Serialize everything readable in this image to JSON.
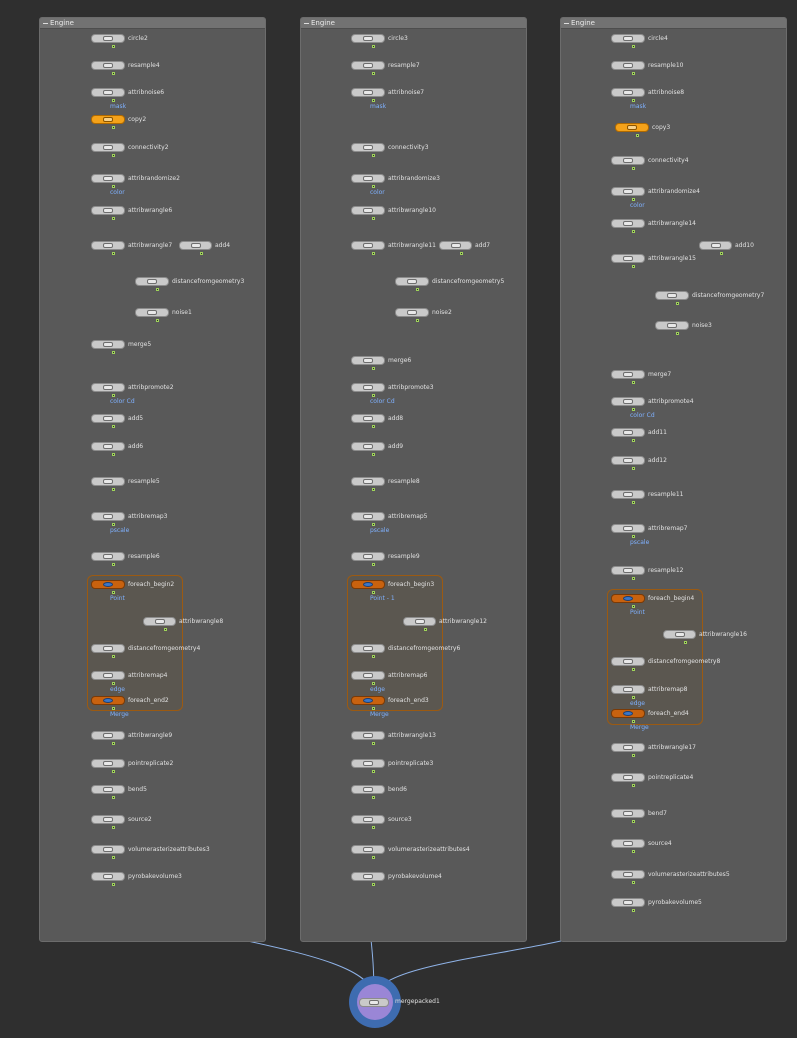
{
  "network": {
    "boxes": [
      {
        "title": "Engine"
      },
      {
        "title": "Engine"
      },
      {
        "title": "Engine"
      }
    ],
    "merge_node": {
      "label": "mergepacked1"
    },
    "columns": [
      {
        "nodes": [
          {
            "label": "circle2"
          },
          {
            "label": "resample4"
          },
          {
            "label": "attribnoise6",
            "sub": "mask"
          },
          {
            "label": "copy2"
          },
          {
            "label": "connectivity2"
          },
          {
            "label": "attribrandomize2",
            "sub": "color"
          },
          {
            "label": "attribwrangle6"
          },
          {
            "label": "attribwrangle7"
          },
          {
            "label": "add4"
          },
          {
            "label": "distancefromgeometry3"
          },
          {
            "label": "noise1"
          },
          {
            "label": "merge5"
          },
          {
            "label": "attribpromote2",
            "sub": "color Cd"
          },
          {
            "label": "add5"
          },
          {
            "label": "add6"
          },
          {
            "label": "resample5"
          },
          {
            "label": "attribremap3",
            "sub": "pscale"
          },
          {
            "label": "resample6"
          },
          {
            "label": "foreach_begin2",
            "sub": "Point"
          },
          {
            "label": "attribwrangle8"
          },
          {
            "label": "distancefromgeometry4"
          },
          {
            "label": "attribremap4",
            "sub": "edge"
          },
          {
            "label": "foreach_end2",
            "sub": "Merge"
          },
          {
            "label": "attribwrangle9"
          },
          {
            "label": "pointreplicate2"
          },
          {
            "label": "bend5"
          },
          {
            "label": "source2"
          },
          {
            "label": "volumerasterizeattributes3"
          },
          {
            "label": "pyrobakevolume3"
          }
        ]
      },
      {
        "nodes": [
          {
            "label": "circle3"
          },
          {
            "label": "resample7"
          },
          {
            "label": "attribnoise7",
            "sub": "mask"
          },
          {
            "label": "connectivity3"
          },
          {
            "label": "attribrandomize3",
            "sub": "color"
          },
          {
            "label": "attribwrangle10"
          },
          {
            "label": "attribwrangle11"
          },
          {
            "label": "add7"
          },
          {
            "label": "distancefromgeometry5"
          },
          {
            "label": "noise2"
          },
          {
            "label": "merge6"
          },
          {
            "label": "attribpromote3",
            "sub": "color Cd"
          },
          {
            "label": "add8"
          },
          {
            "label": "add9"
          },
          {
            "label": "resample8"
          },
          {
            "label": "attribremap5",
            "sub": "pscale"
          },
          {
            "label": "resample9"
          },
          {
            "label": "foreach_begin3",
            "sub": "Point - 1"
          },
          {
            "label": "attribwrangle12"
          },
          {
            "label": "distancefromgeometry6"
          },
          {
            "label": "attribremap6",
            "sub": "edge"
          },
          {
            "label": "foreach_end3",
            "sub": "Merge"
          },
          {
            "label": "attribwrangle13"
          },
          {
            "label": "pointreplicate3"
          },
          {
            "label": "bend6"
          },
          {
            "label": "source3"
          },
          {
            "label": "volumerasterizeattributes4"
          },
          {
            "label": "pyrobakevolume4"
          }
        ]
      },
      {
        "nodes": [
          {
            "label": "circle4"
          },
          {
            "label": "resample10"
          },
          {
            "label": "attribnoise8",
            "sub": "mask"
          },
          {
            "label": "copy3"
          },
          {
            "label": "connectivity4"
          },
          {
            "label": "attribrandomize4",
            "sub": "color"
          },
          {
            "label": "attribwrangle14"
          },
          {
            "label": "attribwrangle15"
          },
          {
            "label": "add10"
          },
          {
            "label": "distancefromgeometry7"
          },
          {
            "label": "noise3"
          },
          {
            "label": "merge7"
          },
          {
            "label": "attribpromote4",
            "sub": "color Cd"
          },
          {
            "label": "add11"
          },
          {
            "label": "add12"
          },
          {
            "label": "resample11"
          },
          {
            "label": "attribremap7",
            "sub": "pscale"
          },
          {
            "label": "resample12"
          },
          {
            "label": "foreach_begin4",
            "sub": "Point"
          },
          {
            "label": "attribwrangle16"
          },
          {
            "label": "distancefromgeometry8"
          },
          {
            "label": "attribremap8",
            "sub": "edge"
          },
          {
            "label": "foreach_end4",
            "sub": "Merge"
          },
          {
            "label": "attribwrangle17"
          },
          {
            "label": "pointreplicate4"
          },
          {
            "label": "bend7"
          },
          {
            "label": "source4"
          },
          {
            "label": "volumerasterizeattributes5"
          },
          {
            "label": "pyrobakevolume5"
          }
        ]
      }
    ]
  }
}
